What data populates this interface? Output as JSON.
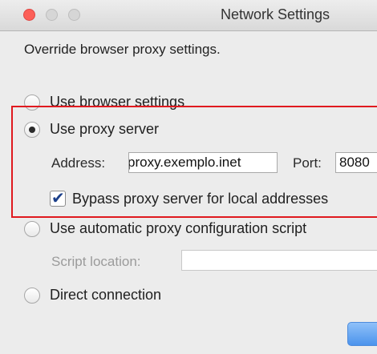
{
  "window": {
    "title": "Network Settings"
  },
  "subtitle": "Override browser proxy settings.",
  "options": {
    "use_browser": {
      "label": "Use browser settings",
      "selected": false
    },
    "use_proxy": {
      "label": "Use proxy server",
      "selected": true
    },
    "use_auto": {
      "label": "Use automatic proxy configuration script",
      "selected": false
    },
    "direct": {
      "label": "Direct connection",
      "selected": false
    }
  },
  "proxy": {
    "address_label": "Address:",
    "address_value": "proxy.exemplo.inet",
    "port_label": "Port:",
    "port_value": "8080",
    "bypass_label": "Bypass proxy server for local addresses",
    "bypass_checked": true
  },
  "auto_script": {
    "location_label": "Script location:",
    "location_value": ""
  },
  "colors": {
    "highlight": "#e0191f",
    "button_accent": "#4b93ec",
    "close_button": "#fc5f57"
  }
}
